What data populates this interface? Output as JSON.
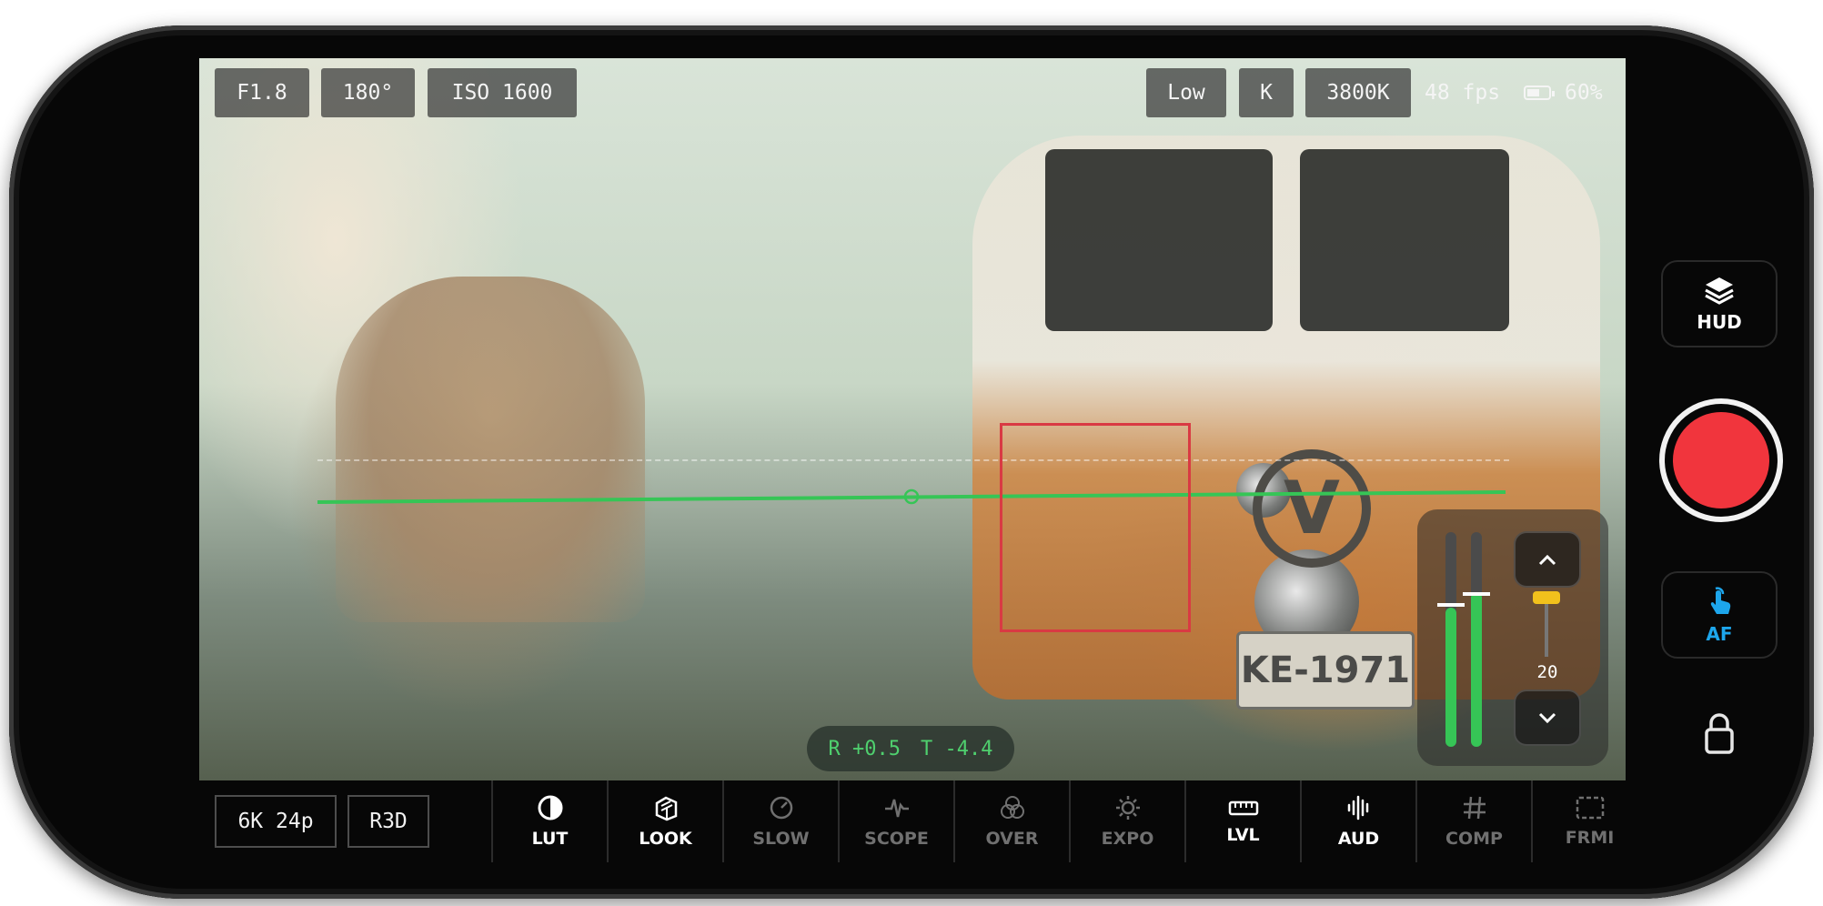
{
  "top_left_chips": [
    "F1.8",
    "180°",
    "ISO 1600"
  ],
  "top_right": {
    "chips": [
      "Low",
      "K",
      "3800K"
    ],
    "fps": "48 fps",
    "battery": "60%",
    "battery_level": 0.6
  },
  "plate_text": "KE-1971",
  "level_readout": {
    "roll": "R +0.5",
    "tilt": "T -4.4"
  },
  "audio": {
    "gain": "20",
    "left_level": 0.65,
    "right_level": 0.72
  },
  "format": {
    "resolution": "6K 24p",
    "codec": "R3D"
  },
  "tools": [
    {
      "label": "LUT",
      "icon": "contrast-icon",
      "active": true
    },
    {
      "label": "LOOK",
      "icon": "layers-cube-icon",
      "active": true
    },
    {
      "label": "SLOW",
      "icon": "speedometer-icon",
      "active": false
    },
    {
      "label": "SCOPE",
      "icon": "waveform-icon",
      "active": false
    },
    {
      "label": "OVER",
      "icon": "overlay-circles-icon",
      "active": false
    },
    {
      "label": "EXPO",
      "icon": "sun-icon",
      "active": false
    },
    {
      "label": "LVL",
      "icon": "ruler-icon",
      "active": true
    },
    {
      "label": "AUD",
      "icon": "audio-bars-icon",
      "active": true
    },
    {
      "label": "COMP",
      "icon": "hash-grid-icon",
      "active": false
    },
    {
      "label": "FRMI",
      "icon": "frame-dashed-icon",
      "active": false
    }
  ],
  "side": {
    "hud_label": "HUD",
    "af_label": "AF"
  },
  "colors": {
    "record": "#f1353d",
    "af_accent": "#1da6ec",
    "level": "#36c556",
    "focus_box": "#d93a43",
    "gain_knob": "#f2c11c"
  }
}
